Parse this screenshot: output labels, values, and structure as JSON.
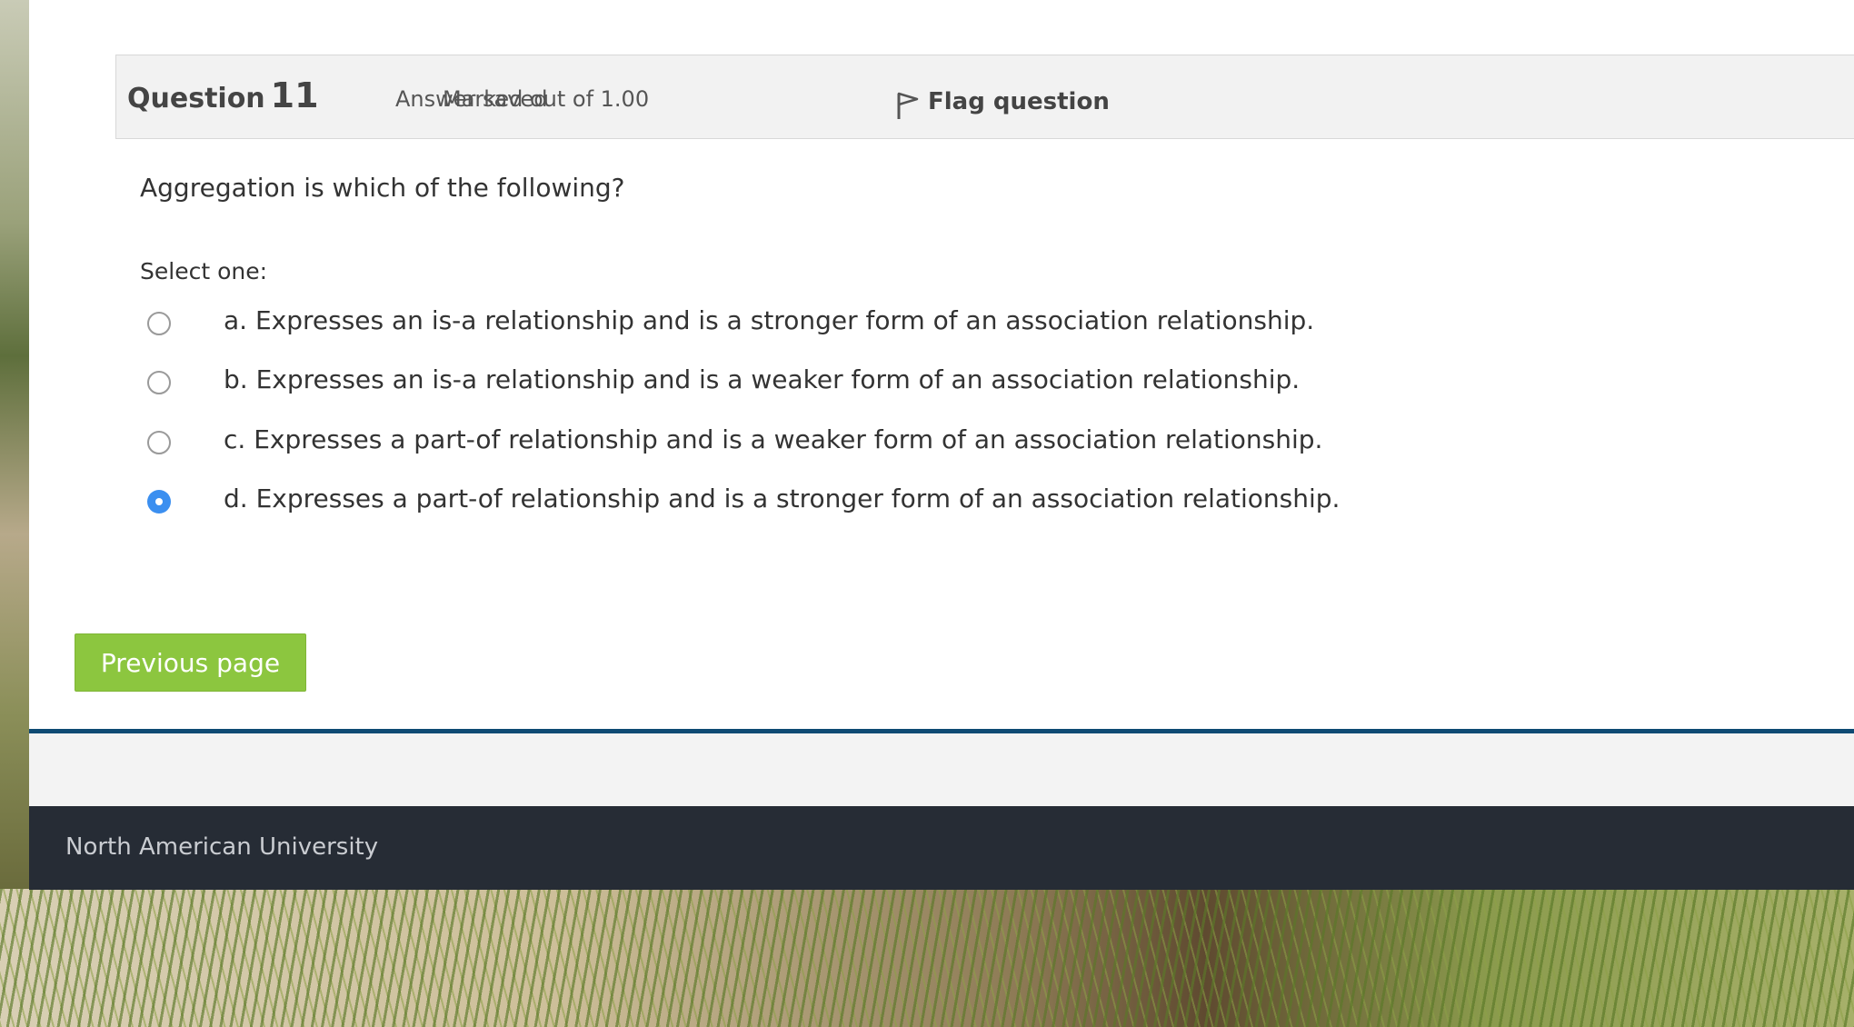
{
  "question": {
    "label": "Question",
    "number": "11",
    "state": "Answer saved",
    "grade": "Marked out of 1.00",
    "flag_label": "Flag question",
    "text": "Aggregation is which of the following?",
    "prompt": "Select one:",
    "answers": [
      {
        "label": "a. Expresses an is-a relationship and is a stronger form of an association relationship.",
        "selected": false
      },
      {
        "label": "b. Expresses an is-a relationship and is a weaker form of an association relationship.",
        "selected": false
      },
      {
        "label": "c. Expresses a part-of relationship and is a weaker form of an association relationship.",
        "selected": false
      },
      {
        "label": "d. Expresses a part-of relationship and is a stronger form of an association relationship.",
        "selected": true
      }
    ]
  },
  "navigation": {
    "previous_label": "Previous page"
  },
  "footer": {
    "site_name": "North American University"
  },
  "colors": {
    "button_green": "#8cc63f",
    "radio_selected": "#3b8ff0",
    "footer_dark": "#262c35",
    "footer_accent": "#0e4a73"
  },
  "icons": {
    "flag": "flag-icon"
  }
}
